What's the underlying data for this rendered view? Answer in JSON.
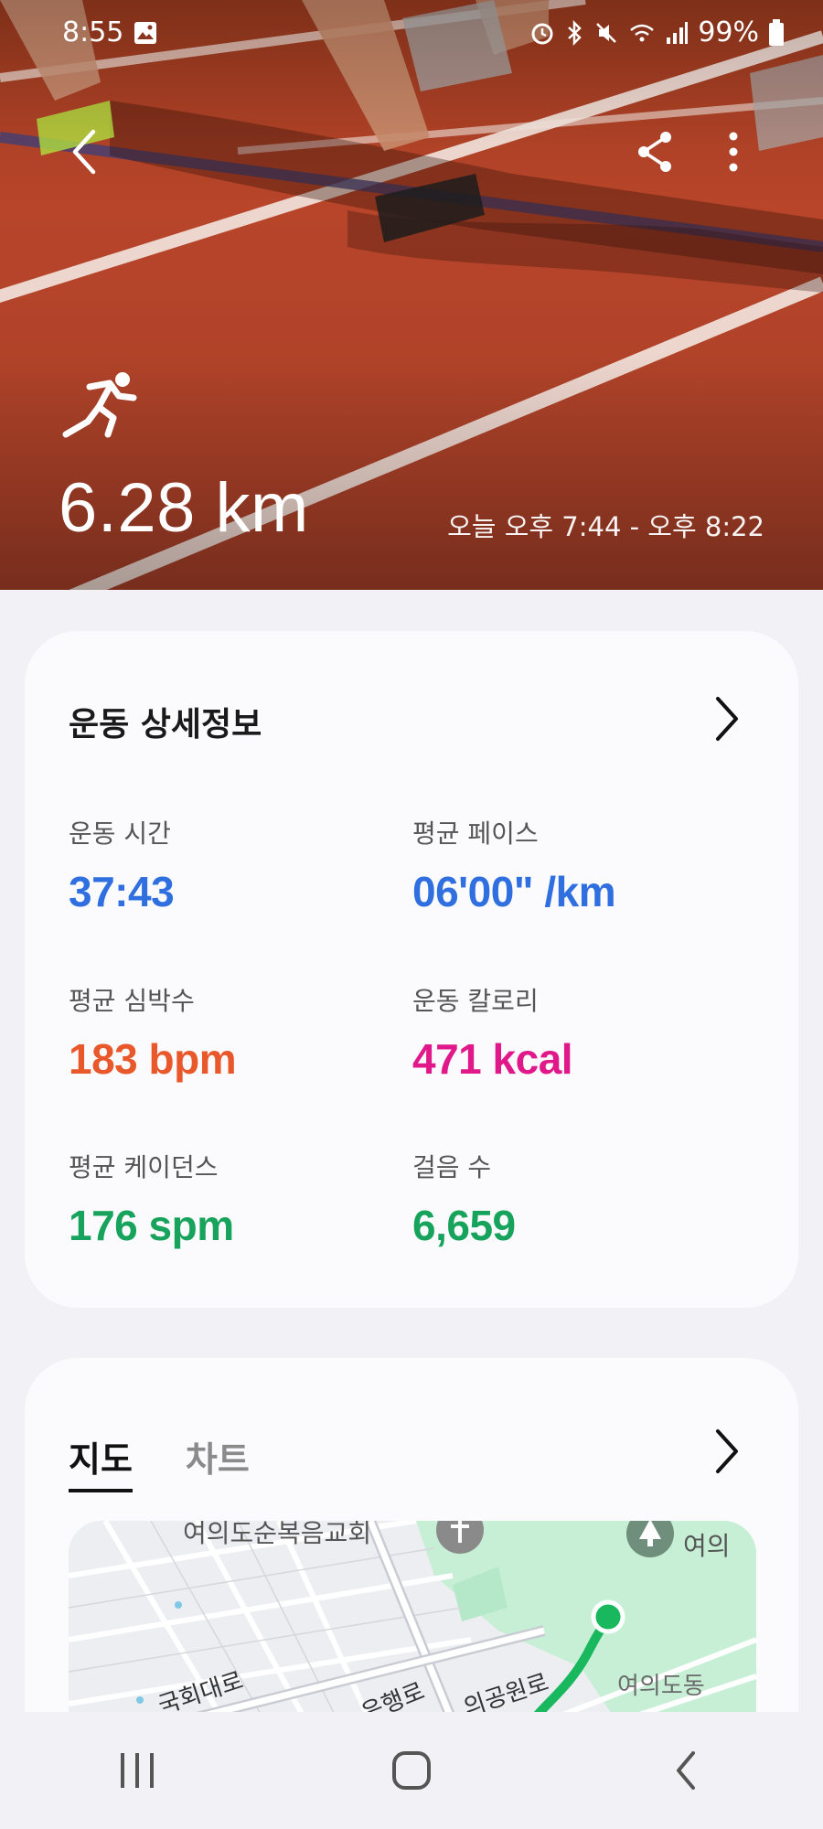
{
  "status_bar": {
    "time": "8:55",
    "battery": "99%",
    "icons": [
      "image-icon",
      "alarm-icon",
      "bluetooth-icon",
      "mute-icon",
      "wifi-icon",
      "signal-icon",
      "battery-icon"
    ]
  },
  "hero": {
    "activity_icon": "running-icon",
    "distance": "6.28 km",
    "time_range": "오늘 오후 7:44 - 오후 8:22"
  },
  "detail_card": {
    "title": "운동 상세정보",
    "metrics": [
      {
        "label": "운동 시간",
        "value": "37:43"
      },
      {
        "label": "평균 페이스",
        "value": "06'00\" /km"
      },
      {
        "label": "평균 심박수",
        "value": "183 bpm"
      },
      {
        "label": "운동 칼로리",
        "value": "471 kcal"
      },
      {
        "label": "평균 케이던스",
        "value": "176 spm"
      },
      {
        "label": "걸음 수",
        "value": "6,659"
      }
    ]
  },
  "map_card": {
    "tabs": [
      {
        "label": "지도",
        "active": true
      },
      {
        "label": "차트",
        "active": false
      }
    ],
    "map_labels": {
      "church": "여의도순복음교회",
      "park": "여의",
      "dong": "여의도동",
      "road1": "국회대로",
      "road2": "은행로",
      "road3": "의공원로"
    }
  },
  "colors": {
    "time": "#2f6fdf",
    "pace": "#2f6fdf",
    "heart_rate": "#e8582a",
    "calories": "#e0188a",
    "cadence": "#17a35c",
    "steps": "#17a35c",
    "route": "#19b85e"
  }
}
